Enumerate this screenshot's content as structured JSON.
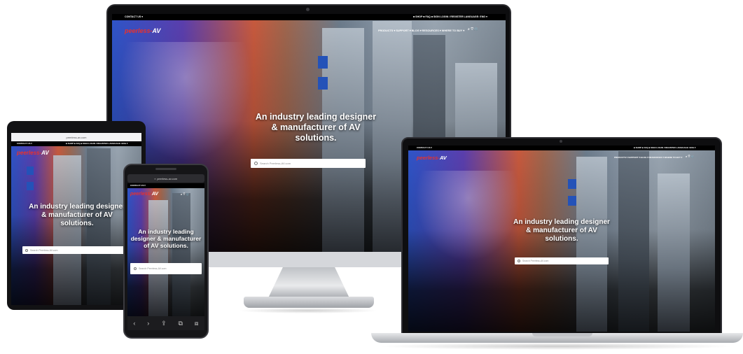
{
  "site": {
    "logo_text": "peerless-",
    "logo_accent": "AV",
    "topbar_link": "CONTACT US ▾",
    "utility_links": "■ SHOP   ■ FAQ   ■ SIGN   LOGIN / REGISTER   LANGUAGE: ENG ▾",
    "nav_items": "PRODUCTS ▾   SUPPORT ▾   BLOG ▾   RESOURCES ▾   WHERE TO BUY ▾",
    "nav_icons": "⌕  ♡  🛒",
    "hero_line1": "An industry leading designer",
    "hero_line2": "& manufacturer of AV",
    "hero_line3": "solutions.",
    "search_placeholder": "Search Peerless-AV.com",
    "url": "peerless-av.com"
  },
  "phone": {
    "hero_line1": "An industry leading",
    "hero_line2": "designer & manufacturer",
    "hero_line3": "of AV solutions.",
    "toolbar_icons": [
      "‹",
      "›",
      "⇪",
      "⧉",
      "⧈"
    ]
  },
  "colors": {
    "brand_red": "#e8322d",
    "topbar": "#000000",
    "hero_text": "#ffffff",
    "device_frame": "#0d0d0f",
    "device_silver": "#d5d7db"
  },
  "icons": [
    "search-icon",
    "heart-icon",
    "cart-icon",
    "lock-icon",
    "reload-icon",
    "back-icon",
    "forward-icon",
    "share-icon",
    "bookmarks-icon",
    "tabs-icon",
    "camera-icon"
  ]
}
